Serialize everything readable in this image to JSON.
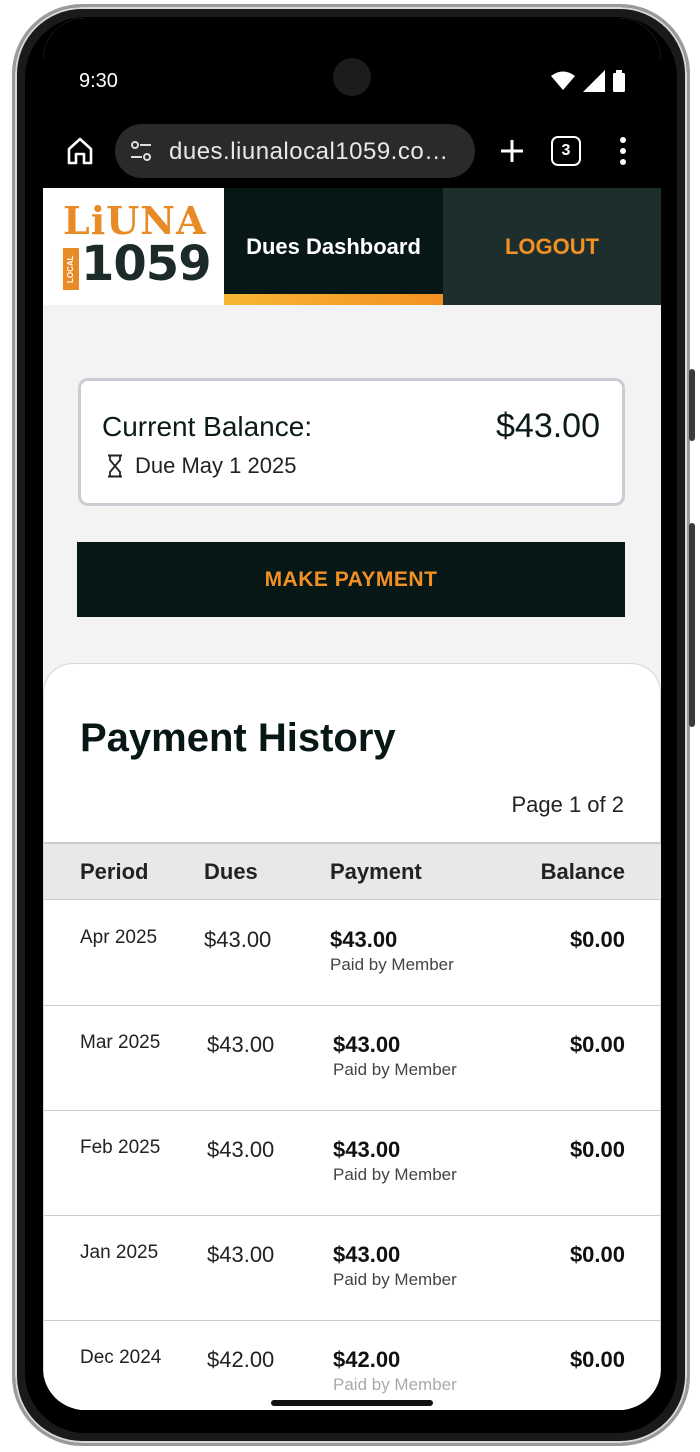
{
  "status_bar": {
    "time": "9:30"
  },
  "browser": {
    "url": "dues.liunalocal1059.co…",
    "tab_count": "3"
  },
  "header": {
    "logo_top": "LiUNA",
    "logo_local": "LOCAL",
    "logo_number": "1059",
    "nav_dashboard": "Dues Dashboard",
    "nav_logout": "LOGOUT"
  },
  "balance": {
    "label": "Current Balance:",
    "amount": "$43.00",
    "due": "Due May 1 2025"
  },
  "make_payment_label": "MAKE PAYMENT",
  "history": {
    "title": "Payment History",
    "page": "Page 1 of 2",
    "columns": [
      "Period",
      "Dues",
      "Payment",
      "Balance"
    ],
    "rows": [
      {
        "period": "Apr 2025",
        "dues": "$43.00",
        "payment": "$43.00",
        "note": "Paid by Member",
        "balance": "$0.00"
      },
      {
        "period": "Mar 2025",
        "dues": "$43.00",
        "payment": "$43.00",
        "note": "Paid by Member",
        "balance": "$0.00"
      },
      {
        "period": "Feb 2025",
        "dues": "$43.00",
        "payment": "$43.00",
        "note": "Paid by Member",
        "balance": "$0.00"
      },
      {
        "period": "Jan 2025",
        "dues": "$43.00",
        "payment": "$43.00",
        "note": "Paid by Member",
        "balance": "$0.00"
      },
      {
        "period": "Dec 2024",
        "dues": "$42.00",
        "payment": "$42.00",
        "note": "Paid by Member",
        "balance": "$0.00"
      }
    ]
  },
  "colors": {
    "accent": "#f39024",
    "dark": "#071716"
  }
}
